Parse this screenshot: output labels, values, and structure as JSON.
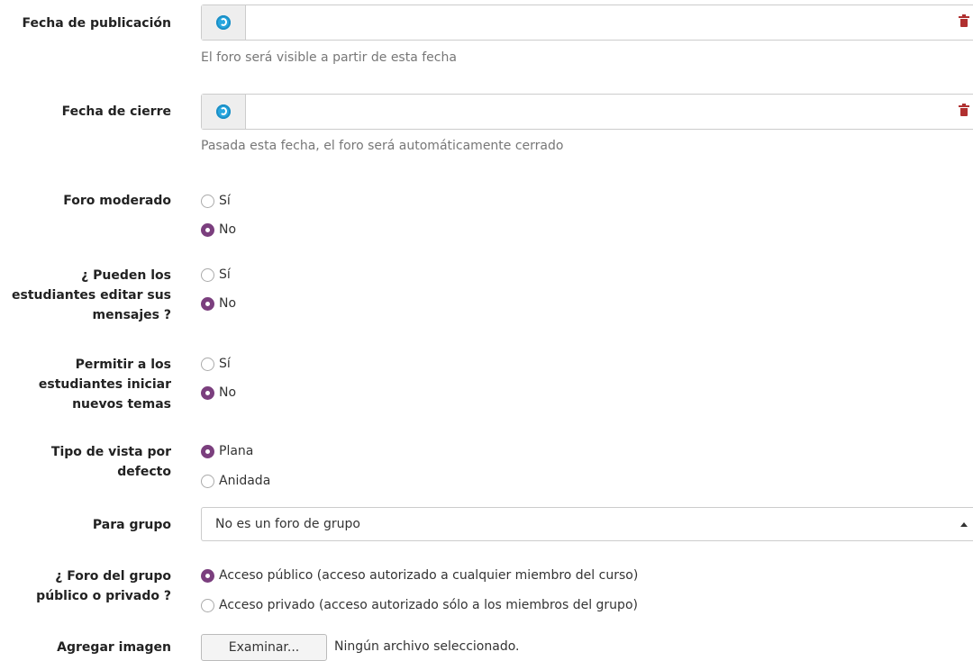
{
  "fields": {
    "publication_date": {
      "label": "Fecha de publicación",
      "value": "",
      "help": "El foro será visible a partir de esta fecha"
    },
    "closing_date": {
      "label": "Fecha de cierre",
      "value": "",
      "help": "Pasada esta fecha, el foro será automáticamente cerrado"
    },
    "moderated": {
      "label": "Foro moderado",
      "options": [
        "Sí",
        "No"
      ],
      "selected": "No"
    },
    "students_edit": {
      "label_lines": [
        "¿ Pueden los",
        "estudiantes editar sus",
        "mensajes ?"
      ],
      "options": [
        "Sí",
        "No"
      ],
      "selected": "No"
    },
    "students_start": {
      "label_lines": [
        "Permitir a los",
        "estudiantes iniciar",
        "nuevos temas"
      ],
      "options": [
        "Sí",
        "No"
      ],
      "selected": "No"
    },
    "view_type": {
      "label_lines": [
        "Tipo de vista por",
        "defecto"
      ],
      "options": [
        "Plana",
        "Anidada"
      ],
      "selected": "Plana"
    },
    "for_group": {
      "label": "Para grupo",
      "selected": "No es un foro de grupo"
    },
    "group_visibility": {
      "label_lines": [
        "¿ Foro del grupo",
        "público o privado ?"
      ],
      "options": [
        "Acceso público (acceso autorizado a cualquier miembro del curso)",
        "Acceso privado (acceso autorizado sólo a los miembros del grupo)"
      ],
      "selected": "Acceso público (acceso autorizado a cualquier miembro del curso)"
    },
    "image": {
      "label": "Agregar imagen",
      "button_label": "Examinar...",
      "status": "Ningún archivo seleccionado."
    }
  },
  "colors": {
    "accent_radio": "#7b3f7e",
    "delete_icon": "#b03030",
    "globe_icon": "#29a7df",
    "help_text": "#777777"
  },
  "icons": {
    "date_addon": "globe-icon",
    "delete": "trash-icon",
    "select_caret": "caret-up-icon"
  }
}
